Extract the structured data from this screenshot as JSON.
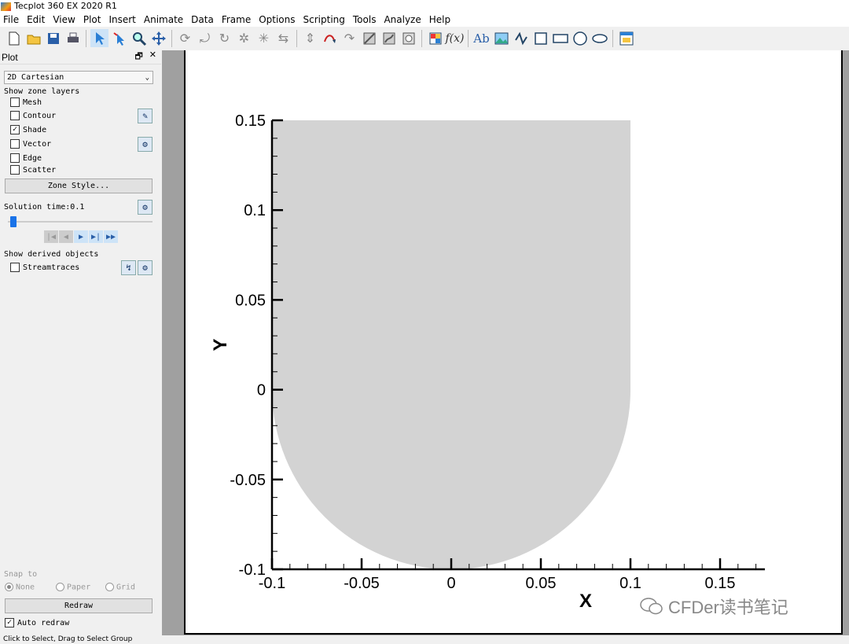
{
  "app": {
    "title": "Tecplot 360 EX 2020 R1"
  },
  "menu": [
    "File",
    "Edit",
    "View",
    "Plot",
    "Insert",
    "Animate",
    "Data",
    "Frame",
    "Options",
    "Scripting",
    "Tools",
    "Analyze",
    "Help"
  ],
  "panel": {
    "title": "Plot",
    "plot_type": "2D Cartesian",
    "show_zone_layers": "Show zone layers",
    "layers": [
      {
        "label": "Mesh",
        "checked": false
      },
      {
        "label": "Contour",
        "checked": false
      },
      {
        "label": "Shade",
        "checked": true
      },
      {
        "label": "Vector",
        "checked": false
      },
      {
        "label": "Edge",
        "checked": false
      },
      {
        "label": "Scatter",
        "checked": false
      }
    ],
    "zone_style": "Zone Style...",
    "solution_time_label": "Solution time:",
    "solution_time_value": "0.1",
    "show_derived": "Show derived objects",
    "streamtraces": "Streamtraces",
    "snap_to": "Snap to",
    "snap_none": "None",
    "snap_paper": "Paper",
    "snap_grid": "Grid",
    "redraw": "Redraw",
    "auto_redraw": "Auto redraw"
  },
  "status": "Click to Select, Drag to Select Group",
  "watermark": "CFDer读书笔记",
  "chart_data": {
    "type": "area",
    "xlabel": "X",
    "ylabel": "Y",
    "xlim": [
      -0.1,
      0.175
    ],
    "ylim": [
      -0.1,
      0.15
    ],
    "x_ticks": [
      -0.1,
      -0.05,
      0,
      0.05,
      0.1,
      0.15
    ],
    "x_tick_labels": [
      "-0.1",
      "-0.05",
      "0",
      "0.05",
      "0.1",
      "0.15"
    ],
    "y_ticks": [
      -0.1,
      -0.05,
      0,
      0.05,
      0.1,
      0.15
    ],
    "y_tick_labels": [
      "-0.1",
      "-0.05",
      "0",
      "0.05",
      "0.1",
      "0.15"
    ],
    "fill_color": "#d3d3d3",
    "shape": {
      "rect": {
        "x0": -0.1,
        "x1": 0.1,
        "y0": 0,
        "y1": 0.15
      },
      "semicircle": {
        "cx": 0,
        "cy": 0,
        "r": 0.1,
        "side": "below"
      }
    },
    "grid": false
  }
}
